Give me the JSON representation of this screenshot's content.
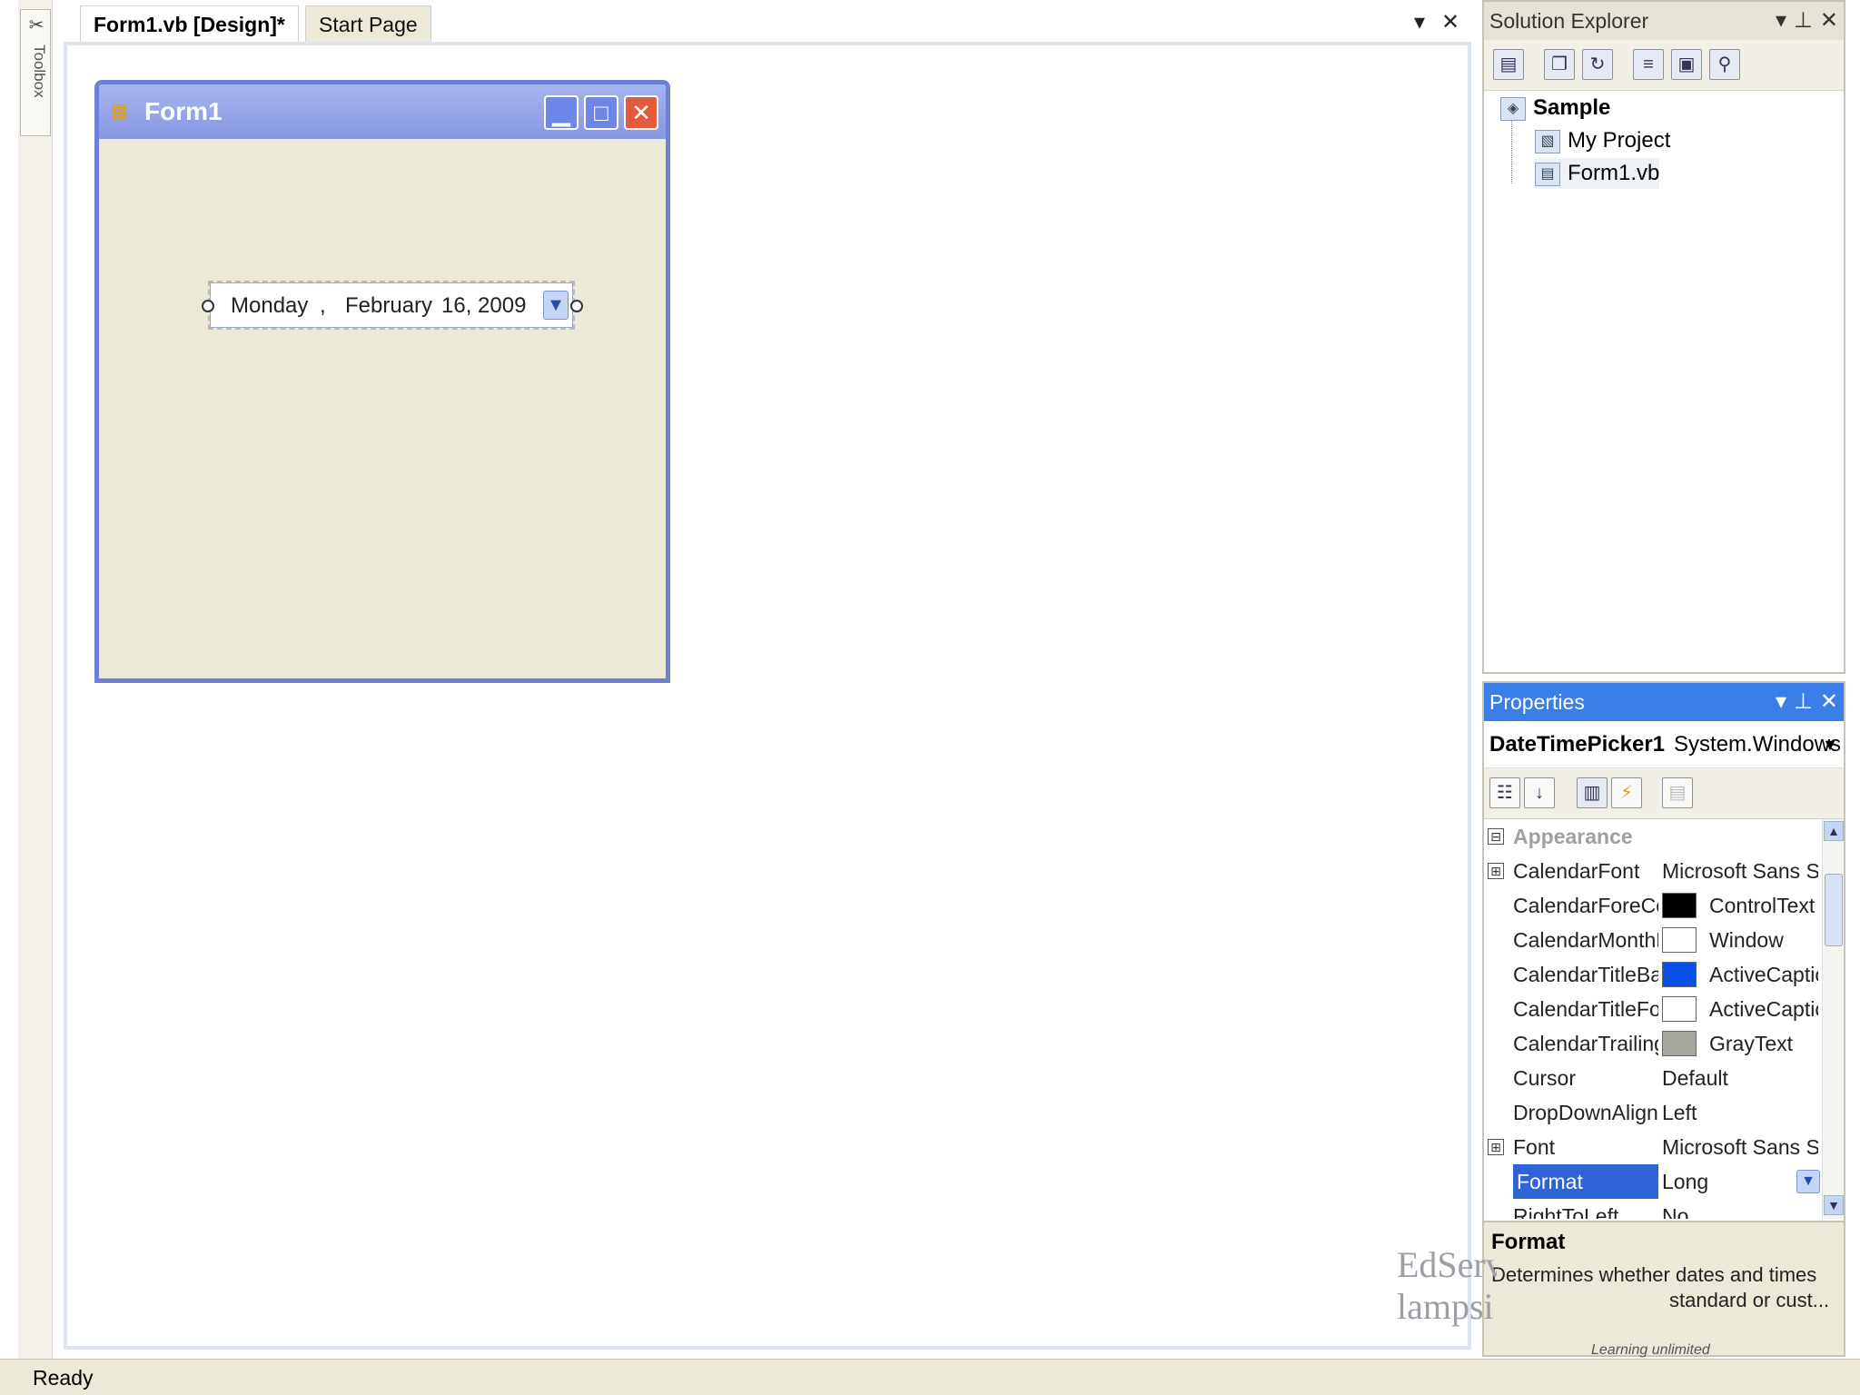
{
  "toolbox": {
    "label": "Toolbox"
  },
  "tabs": [
    {
      "label": "Form1.vb [Design]*",
      "active": true
    },
    {
      "label": "Start Page",
      "active": false
    }
  ],
  "tab_controls": {
    "dropdown": "▾",
    "close": "✕"
  },
  "form": {
    "title": "Form1",
    "controls": {
      "minimize": "▁",
      "maximize": "□",
      "close": "✕"
    },
    "datetimepicker": {
      "day": "Monday",
      "sep": ",",
      "month": "February",
      "date": "16, 2009"
    }
  },
  "solution_explorer": {
    "title": "Solution Explorer",
    "items": [
      {
        "label": "Sample",
        "bold": true,
        "icon": "solution-icon"
      },
      {
        "label": "My Project",
        "icon": "project-properties-icon"
      },
      {
        "label": "Form1.vb",
        "icon": "form-file-icon"
      }
    ]
  },
  "properties": {
    "title": "Properties",
    "object_name": "DateTimePicker1",
    "object_type": "System.Windows",
    "rows": [
      {
        "name": "Appearance",
        "value": "",
        "category": true,
        "expander": "⊟"
      },
      {
        "name": "CalendarFont",
        "value": "Microsoft Sans Se",
        "expander": "⊞"
      },
      {
        "name": "CalendarForeCo",
        "value": "ControlText",
        "swatch": "#000000"
      },
      {
        "name": "CalendarMonthB",
        "value": "Window",
        "swatch": "#ffffff"
      },
      {
        "name": "CalendarTitleBac",
        "value": "ActiveCaptic",
        "swatch": "#0a50e6"
      },
      {
        "name": "CalendarTitleFor",
        "value": "ActiveCaptic",
        "swatch": "#ffffff"
      },
      {
        "name": "CalendarTrailingI",
        "value": "GrayText",
        "swatch": "#a8a8a0"
      },
      {
        "name": "Cursor",
        "value": "Default"
      },
      {
        "name": "DropDownAlign",
        "value": "Left"
      },
      {
        "name": "Font",
        "value": "Microsoft Sans Se",
        "expander": "⊞"
      },
      {
        "name": "Format",
        "value": "Long",
        "selected": true
      },
      {
        "name": "RightToLeft",
        "value": "No"
      }
    ],
    "description": {
      "title": "Format",
      "text": "Determines whether dates and times",
      "text2": "standard or cust..."
    }
  },
  "watermark": {
    "line1": "EdServ",
    "line2": "lampsi",
    "sub": "Learning unlimited"
  },
  "status": {
    "text": "Ready"
  },
  "colors": {
    "accent": "#3b7ee8",
    "form_border": "#6f7fd8",
    "form_bg": "#ece9d8"
  }
}
